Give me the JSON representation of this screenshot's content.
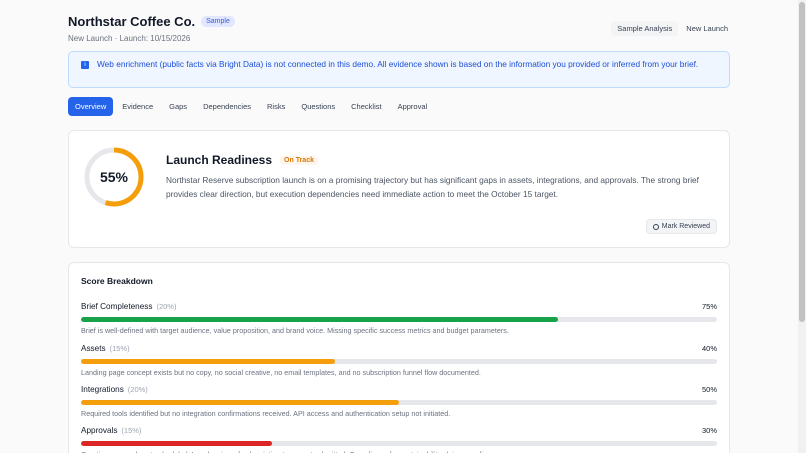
{
  "header": {
    "company": "Northstar Coffee Co.",
    "sample_badge": "Sample",
    "subline": "New Launch · Launch: 10/15/2026",
    "btn_sample_analysis": "Sample Analysis",
    "btn_new_launch": "New Launch"
  },
  "banner": {
    "icon": "info-icon",
    "text": "Web enrichment (public facts via Bright Data) is not connected in this demo. All evidence shown is based on the information you provided or inferred from your brief."
  },
  "tabs": [
    "Overview",
    "Evidence",
    "Gaps",
    "Dependencies",
    "Risks",
    "Questions",
    "Checklist",
    "Approval"
  ],
  "active_tab": "Overview",
  "readiness": {
    "score_text": "55%",
    "score_value": 55,
    "ring_color": "#f59e0b",
    "title": "Launch Readiness",
    "status": "On Track",
    "summary": "Northstar Reserve subscription launch is on a promising trajectory but has significant gaps in assets, integrations, and approvals. The strong brief provides clear direction, but execution dependencies need immediate action to meet the October 15 target.",
    "mark_reviewed": "Mark Reviewed"
  },
  "breakdown": {
    "title": "Score Breakdown",
    "items": [
      {
        "name": "Brief Completeness",
        "weight": "(20%)",
        "value_text": "75%",
        "value": 75,
        "color": "#16a34a",
        "desc": "Brief is well-defined with target audience, value proposition, and brand voice. Missing specific success metrics and budget parameters."
      },
      {
        "name": "Assets",
        "weight": "(15%)",
        "value_text": "40%",
        "value": 40,
        "color": "#f59e0b",
        "desc": "Landing page concept exists but no copy, no social creative, no email templates, and no subscription funnel flow documented."
      },
      {
        "name": "Integrations",
        "weight": "(20%)",
        "value_text": "50%",
        "value": 50,
        "color": "#f59e0b",
        "desc": "Required tools identified but no integration confirmations received. API access and authentication setup not initiated."
      },
      {
        "name": "Approvals",
        "weight": "(15%)",
        "value_text": "30%",
        "value": 30,
        "color": "#dc2626",
        "desc": "Creative approvals not scheduled. Legal review of subscription terms not submitted. Compliance for sustainability claims pending."
      }
    ]
  }
}
